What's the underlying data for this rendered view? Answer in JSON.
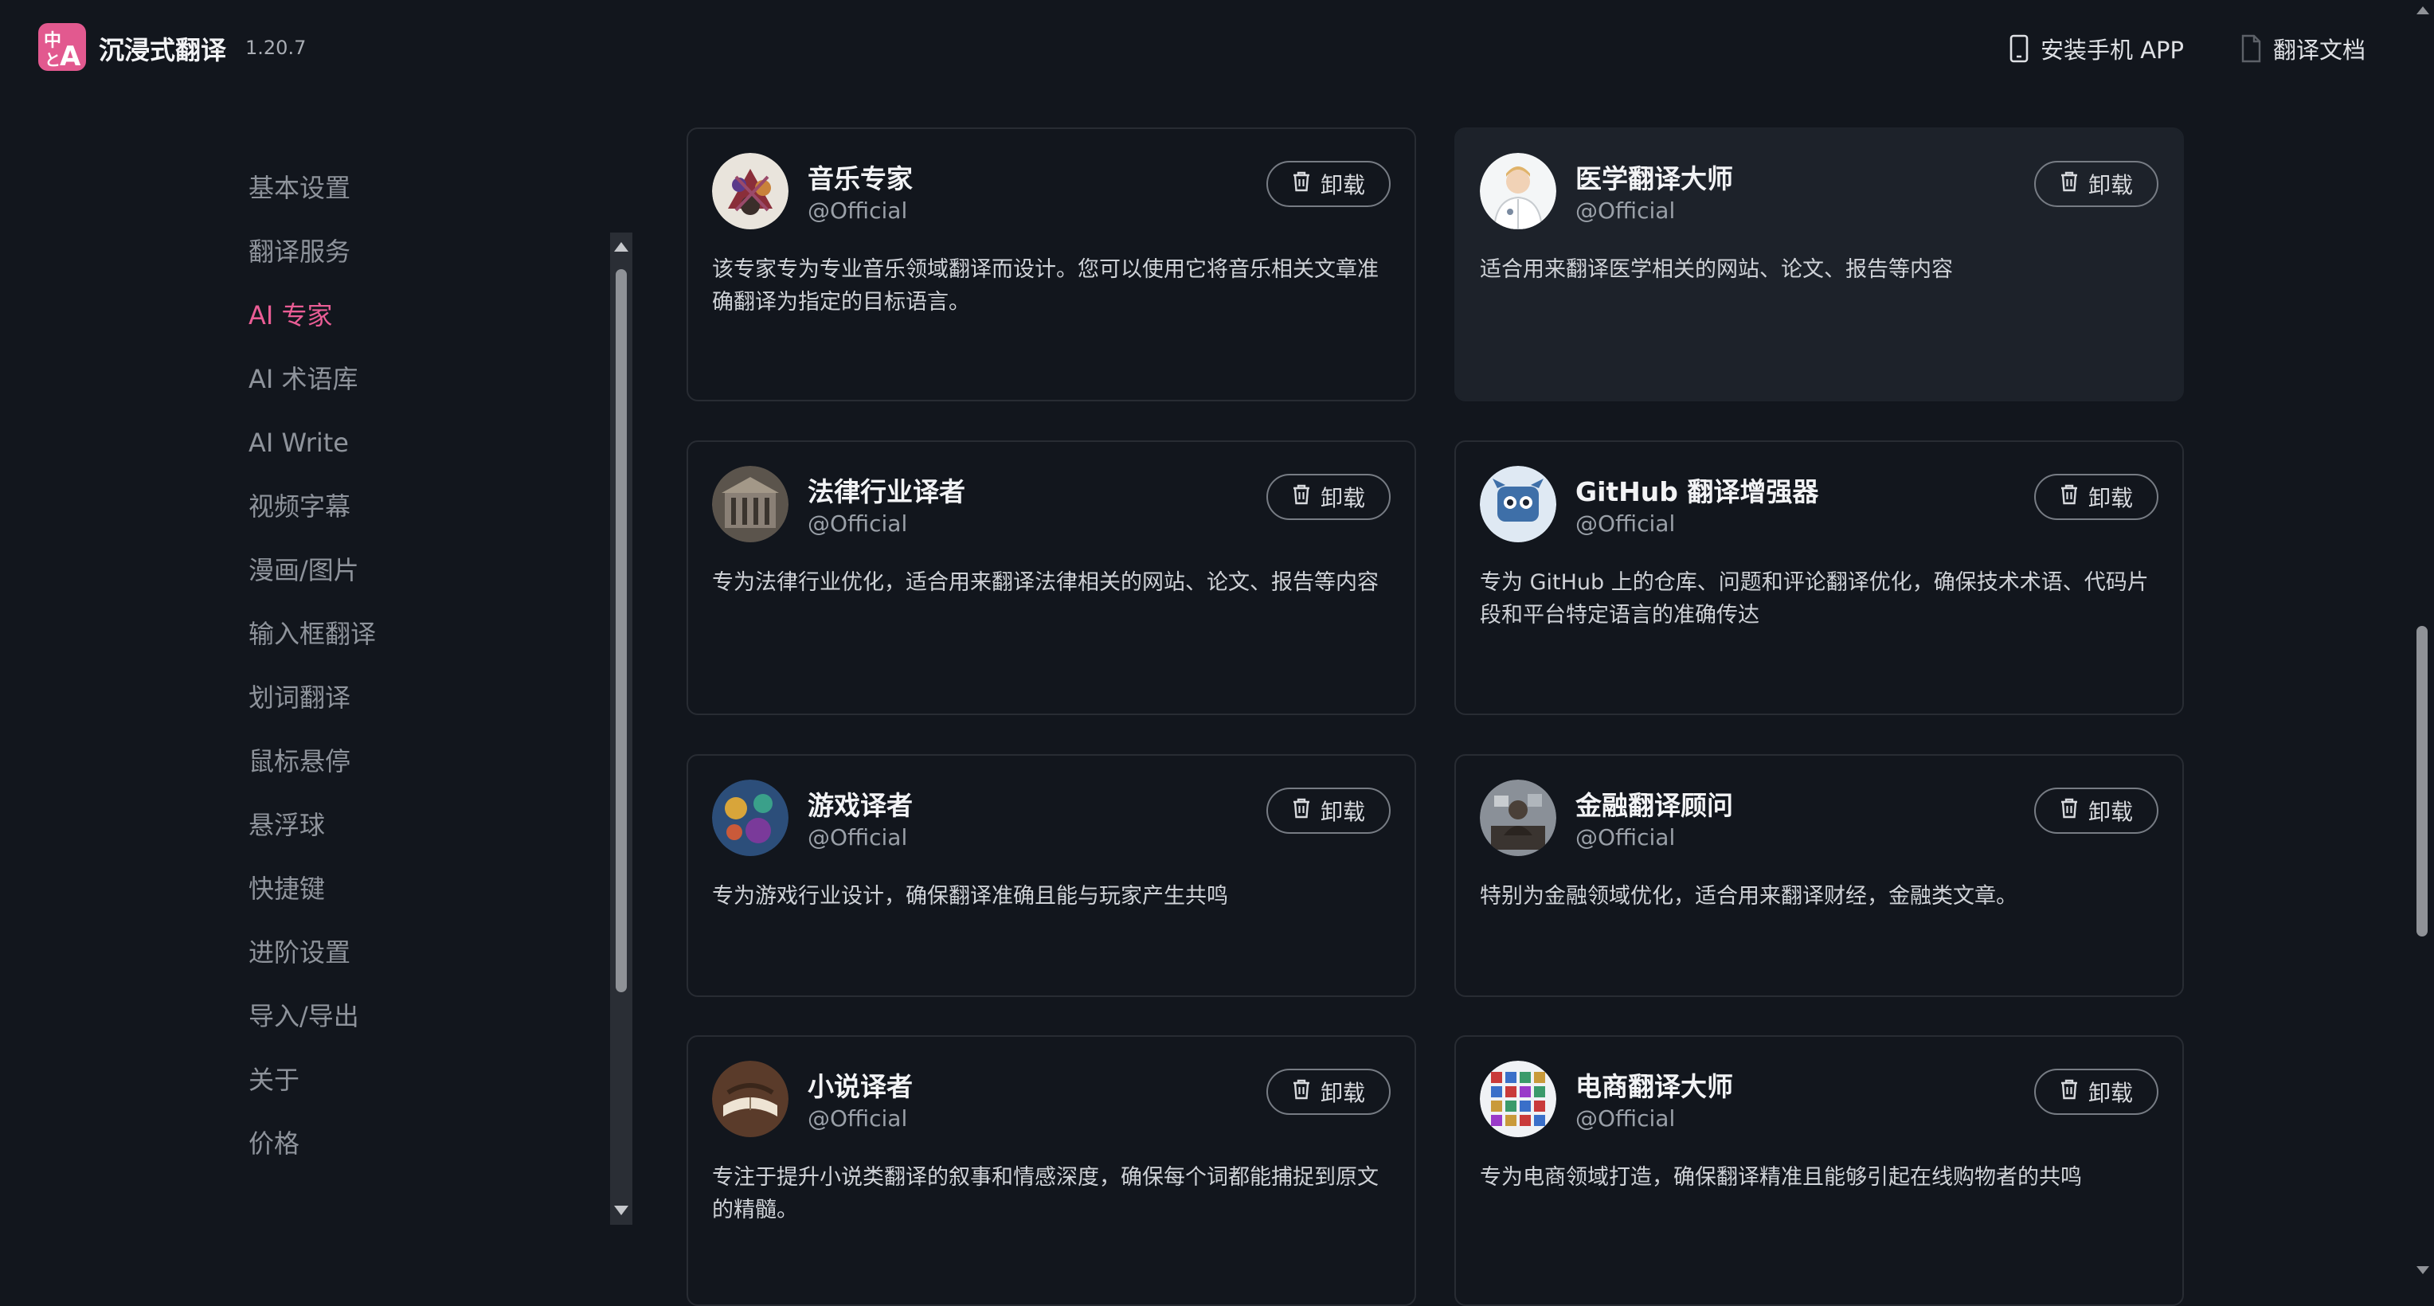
{
  "header": {
    "app_name": "沉浸式翻译",
    "version": "1.20.7",
    "logo_glyphs": [
      "中",
      "A",
      "と"
    ],
    "links": [
      {
        "icon": "mobile-phone-icon",
        "label": "安装手机 APP"
      },
      {
        "icon": "document-icon",
        "label": "翻译文档"
      }
    ]
  },
  "sidebar": {
    "items": [
      {
        "label": "基本设置",
        "active": false
      },
      {
        "label": "翻译服务",
        "active": false
      },
      {
        "label": "AI 专家",
        "active": true
      },
      {
        "label": "AI 术语库",
        "active": false
      },
      {
        "label": "AI Write",
        "active": false
      },
      {
        "label": "视频字幕",
        "active": false
      },
      {
        "label": "漫画/图片",
        "active": false
      },
      {
        "label": "输入框翻译",
        "active": false
      },
      {
        "label": "划词翻译",
        "active": false
      },
      {
        "label": "鼠标悬停",
        "active": false
      },
      {
        "label": "悬浮球",
        "active": false
      },
      {
        "label": "快捷键",
        "active": false
      },
      {
        "label": "进阶设置",
        "active": false
      },
      {
        "label": "导入/导出",
        "active": false
      },
      {
        "label": "关于",
        "active": false
      },
      {
        "label": "价格",
        "active": false
      }
    ]
  },
  "experts": [
    {
      "title": "音乐专家",
      "author": "@Official",
      "button": "卸载",
      "description": "该专家专为专业音乐领域翻译而设计。您可以使用它将音乐相关文章准确翻译为指定的目标语言。",
      "avatar": "music-avatar-icon"
    },
    {
      "title": "医学翻译大师",
      "author": "@Official",
      "button": "卸载",
      "description": "适合用来翻译医学相关的网站、论文、报告等内容",
      "avatar": "doctor-avatar-icon"
    },
    {
      "title": "法律行业译者",
      "author": "@Official",
      "button": "卸载",
      "description": "专为法律行业优化，适合用来翻译法律相关的网站、论文、报告等内容",
      "avatar": "law-avatar-icon"
    },
    {
      "title": "GitHub 翻译增强器",
      "author": "@Official",
      "button": "卸载",
      "description": "专为 GitHub 上的仓库、问题和评论翻译优化，确保技术术语、代码片段和平台特定语言的准确传达",
      "avatar": "github-avatar-icon"
    },
    {
      "title": "游戏译者",
      "author": "@Official",
      "button": "卸载",
      "description": "专为游戏行业设计，确保翻译准确且能与玩家产生共鸣",
      "avatar": "game-avatar-icon"
    },
    {
      "title": "金融翻译顾问",
      "author": "@Official",
      "button": "卸载",
      "description": "特别为金融领域优化，适合用来翻译财经，金融类文章。",
      "avatar": "finance-avatar-icon"
    },
    {
      "title": "小说译者",
      "author": "@Official",
      "button": "卸载",
      "description": "专注于提升小说类翻译的叙事和情感深度，确保每个词都能捕捉到原文的精髓。",
      "avatar": "novel-avatar-icon"
    },
    {
      "title": "电商翻译大师",
      "author": "@Official",
      "button": "卸载",
      "description": "专为电商领域打造，确保翻译精准且能够引起在线购物者的共鸣",
      "avatar": "ecommerce-avatar-icon"
    }
  ],
  "colors": {
    "background": "#12161d",
    "accent": "#ea5d95",
    "card_border": "#282c33",
    "card_highlight": "#1d222a"
  }
}
